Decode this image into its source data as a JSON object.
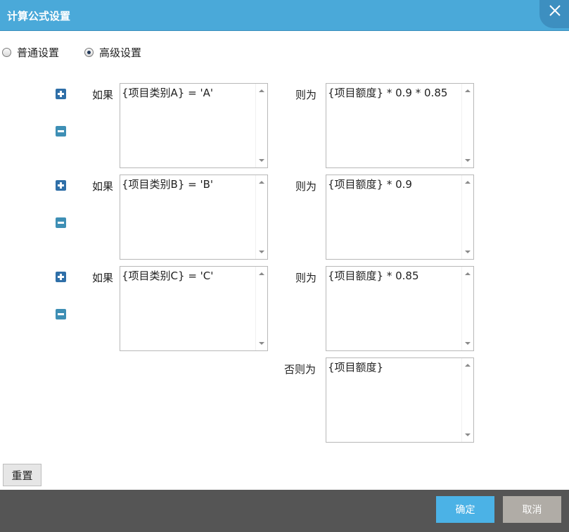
{
  "dialog": {
    "title": "计算公式设置"
  },
  "mode": {
    "options": [
      "普通设置",
      "高级设置"
    ],
    "selected": "高级设置"
  },
  "rules": [
    {
      "if_label": "如果",
      "condition": "{项目类别A} = 'A'",
      "then_label": "则为",
      "result": "{项目额度} * 0.9 * 0.85"
    },
    {
      "if_label": "如果",
      "condition": "{项目类别B} = 'B'",
      "then_label": "则为",
      "result": "{项目额度} * 0.9"
    },
    {
      "if_label": "如果",
      "condition": "{项目类别C} = 'C'",
      "then_label": "则为",
      "result": "{项目额度} * 0.85"
    }
  ],
  "else_rule": {
    "label": "否则为",
    "result": "{项目额度}"
  },
  "buttons": {
    "reset": "重置",
    "ok": "确定",
    "cancel": "取消"
  },
  "colors": {
    "titlebar": "#4aa9d9",
    "footer": "#555555",
    "ok": "#4bb2e6",
    "cancel": "#b0aca6"
  }
}
